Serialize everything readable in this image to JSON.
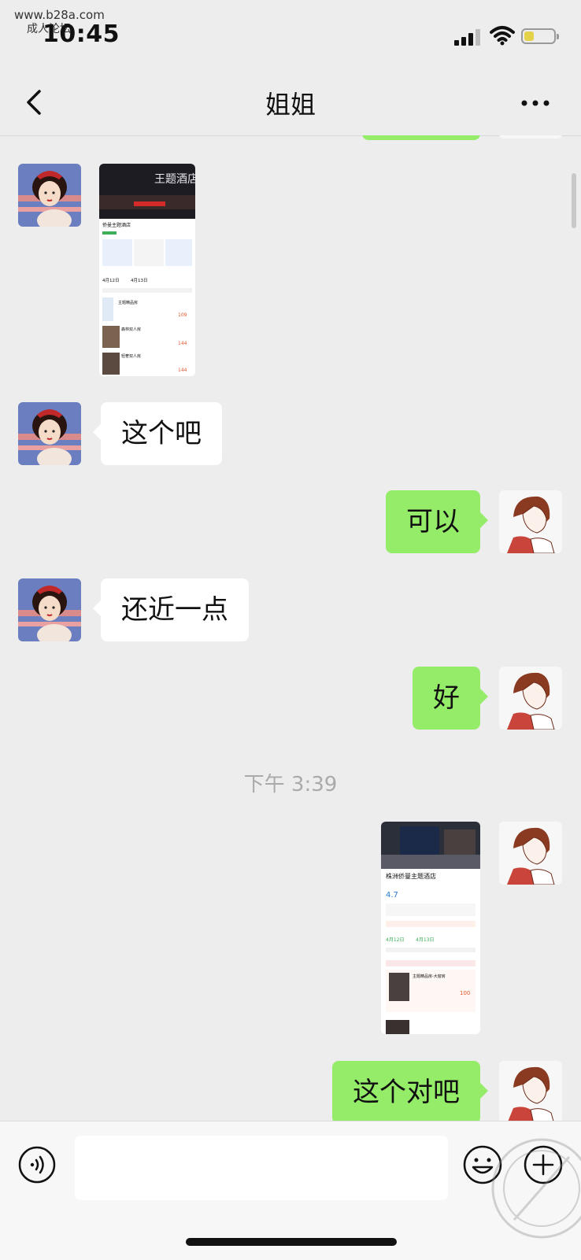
{
  "status": {
    "time": "10:45",
    "watermark_site": "www.b28a.com",
    "watermark_forum": "成人论坛",
    "battery_color": "#e6d24a"
  },
  "nav": {
    "title": "姐姐",
    "back_icon": "chevron-left-icon",
    "more_icon": "more-dots-icon"
  },
  "messages": [
    {
      "side": "in",
      "type": "image",
      "desc_title": "侨曼主题酒店",
      "date_from": "4月12日",
      "date_to": "4月13日",
      "price1": "109",
      "price2": "144",
      "price3": "144",
      "room1": "主题精品房",
      "room2": "森林双人房",
      "room3": "轻奢双人房"
    },
    {
      "side": "in",
      "type": "text",
      "text": "这个吧"
    },
    {
      "side": "out",
      "type": "text",
      "text": "可以"
    },
    {
      "side": "in",
      "type": "text",
      "text": "还近一点"
    },
    {
      "side": "out",
      "type": "text",
      "text": "好"
    },
    {
      "side": "out",
      "type": "image",
      "desc_title": "株洲侨曼主题酒店",
      "rating": "4.7",
      "date_from": "4月12日",
      "date_to": "4月13日",
      "room1": "主题精品房-大窗房",
      "price1": "100"
    },
    {
      "side": "out",
      "type": "text",
      "text": "这个对吧"
    }
  ],
  "time_divider": "下午 3:39",
  "input": {
    "voice_icon": "voice-icon",
    "emoji_icon": "emoji-icon",
    "plus_icon": "plus-icon",
    "value": ""
  },
  "colors": {
    "bg": "#ededed",
    "out_bubble": "#95ec69",
    "in_bubble": "#ffffff"
  }
}
